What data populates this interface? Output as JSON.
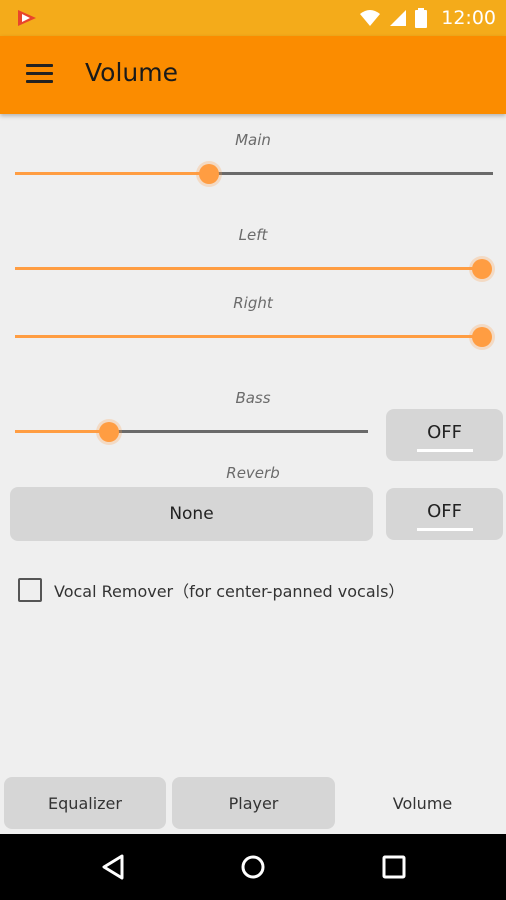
{
  "status_bar": {
    "time": "12:00",
    "icons": [
      "app-notification-icon",
      "wifi-icon",
      "signal-icon",
      "battery-icon"
    ]
  },
  "app_bar": {
    "title": "Volume",
    "menu_icon": "hamburger-menu-icon"
  },
  "sliders": {
    "main": {
      "label": "Main",
      "value_fraction": 0.405
    },
    "left": {
      "label": "Left",
      "value_fraction": 1.0
    },
    "right": {
      "label": "Right",
      "value_fraction": 1.0
    },
    "bass": {
      "label": "Bass",
      "value_fraction": 0.265
    }
  },
  "bass_toggle": {
    "label": "OFF"
  },
  "reverb": {
    "label": "Reverb",
    "selected": "None",
    "toggle_label": "OFF"
  },
  "vocal_remover": {
    "label": "Vocal Remover（for center-panned vocals）",
    "checked": false
  },
  "tabs": [
    {
      "label": "Equalizer",
      "active": false
    },
    {
      "label": "Player",
      "active": false
    },
    {
      "label": "Volume",
      "active": true
    }
  ],
  "nav": {
    "back_icon": "back-triangle-icon",
    "home_icon": "home-circle-icon",
    "recents_icon": "recents-square-icon"
  },
  "colors": {
    "status_bar": "#f4ab1a",
    "app_bar": "#fb8c00",
    "accent": "#ff9d42",
    "track_empty": "#6a6a6a",
    "background": "#efefef",
    "button": "#d6d6d6"
  }
}
